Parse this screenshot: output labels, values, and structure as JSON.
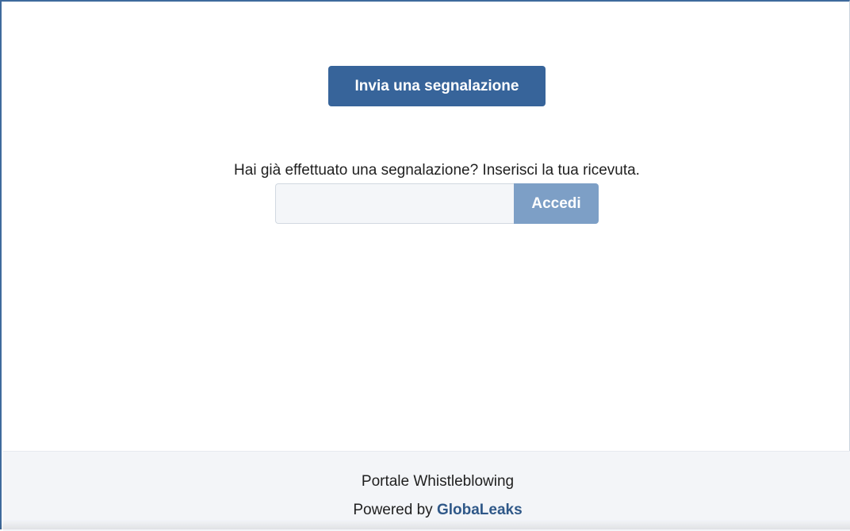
{
  "main": {
    "submit_report_label": "Invia una segnalazione",
    "receipt_prompt": "Hai già effettuato una segnalazione? Inserisci la tua ricevuta.",
    "receipt_input_value": "",
    "login_label": "Accedi"
  },
  "footer": {
    "portal_name": "Portale Whistleblowing",
    "powered_by_prefix": "Powered by",
    "brand_name": "GlobaLeaks"
  },
  "colors": {
    "primary": "#37649a",
    "primary_disabled": "#7d9fc6",
    "frame_border": "#3e6a9c",
    "footer_bg": "#f3f5f8",
    "brand_link": "#2f5888"
  }
}
